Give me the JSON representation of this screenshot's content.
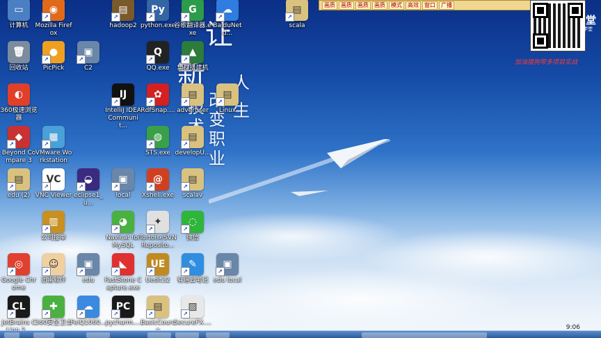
{
  "icons": [
    {
      "label": "计算机",
      "col": 0,
      "row": 0,
      "color": "#4a7fc4",
      "glyph": "▭",
      "sc": false
    },
    {
      "label": "Mozilla Firefox",
      "col": 1,
      "row": 0,
      "color": "#e06a1a",
      "glyph": "◉",
      "sc": true
    },
    {
      "label": "hadoop2",
      "col": 3,
      "row": 0,
      "color": "#7a5a2a",
      "glyph": "▤",
      "sc": true
    },
    {
      "label": "python.exe",
      "col": 4,
      "row": 0,
      "color": "#3465a4",
      "glyph": "Py",
      "sc": true
    },
    {
      "label": "谷歌翻译器.exe",
      "col": 5,
      "row": 0,
      "color": "#2c9c4a",
      "glyph": "G",
      "sc": true
    },
    {
      "label": "BaiduNetd...",
      "col": 6,
      "row": 0,
      "color": "#2f7de0",
      "glyph": "☁",
      "sc": true
    },
    {
      "label": "scala",
      "col": 8,
      "row": 0,
      "color": "#d9c280",
      "glyph": "▤",
      "sc": true
    },
    {
      "label": "回收站",
      "col": 0,
      "row": 1,
      "color": "#7d8c9c",
      "glyph": "🗑",
      "sc": false
    },
    {
      "label": "PicPick",
      "col": 1,
      "row": 1,
      "color": "#f0a020",
      "glyph": "●",
      "sc": true
    },
    {
      "label": "C2",
      "col": 2,
      "row": 1,
      "color": "#6a86a8",
      "glyph": "▣",
      "sc": true
    },
    {
      "label": "QQ.exe",
      "col": 4,
      "row": 1,
      "color": "#222222",
      "glyph": "Q",
      "sc": true
    },
    {
      "label": "集群搭建机",
      "col": 5,
      "row": 1,
      "color": "#2c7c3c",
      "glyph": "▲",
      "sc": true
    },
    {
      "label": "360极速浏览器",
      "col": 0,
      "row": 2,
      "color": "#e0402a",
      "glyph": "◐",
      "sc": false
    },
    {
      "label": "IntelliJ IDEA Communit...",
      "col": 3,
      "row": 2,
      "color": "#111111",
      "glyph": "IJ",
      "sc": true
    },
    {
      "label": "RdfSnap....",
      "col": 4,
      "row": 2,
      "color": "#d42020",
      "glyph": "✿",
      "sc": true
    },
    {
      "label": "advertiser",
      "col": 5,
      "row": 2,
      "color": "#d9c280",
      "glyph": "▤",
      "sc": true
    },
    {
      "label": "Linux",
      "col": 6,
      "row": 2,
      "color": "#d9c280",
      "glyph": "▤",
      "sc": true
    },
    {
      "label": "Beyond Compare 3",
      "col": 0,
      "row": 3,
      "color": "#c83232",
      "glyph": "◆",
      "sc": true
    },
    {
      "label": "VMware Workstation",
      "col": 1,
      "row": 3,
      "color": "#4aa0d8",
      "glyph": "▦",
      "sc": true
    },
    {
      "label": "STS.exe",
      "col": 4,
      "row": 3,
      "color": "#3aa048",
      "glyph": "◍",
      "sc": true
    },
    {
      "label": "developU...",
      "col": 5,
      "row": 3,
      "color": "#d9c280",
      "glyph": "▤",
      "sc": true
    },
    {
      "label": "edu (2)",
      "col": 0,
      "row": 4,
      "color": "#d9c280",
      "glyph": "▤",
      "sc": true
    },
    {
      "label": "VNC Viewer",
      "col": 1,
      "row": 4,
      "color": "#ffffff",
      "glyph": "VC",
      "sc": true
    },
    {
      "label": "eclipse1_u...",
      "col": 2,
      "row": 4,
      "color": "#3a2a80",
      "glyph": "◒",
      "sc": true
    },
    {
      "label": "local",
      "col": 3,
      "row": 4,
      "color": "#6a86a8",
      "glyph": "▣",
      "sc": true
    },
    {
      "label": "Xshell.exe",
      "col": 4,
      "row": 4,
      "color": "#d04020",
      "glyph": "@",
      "sc": true
    },
    {
      "label": "scalav",
      "col": 5,
      "row": 4,
      "color": "#d9c280",
      "glyph": "▤",
      "sc": true
    },
    {
      "label": "公司接单",
      "col": 1,
      "row": 5,
      "color": "#c89020",
      "glyph": "▥",
      "sc": true
    },
    {
      "label": "Navicat for MySQL",
      "col": 3,
      "row": 5,
      "color": "#4ab040",
      "glyph": "◕",
      "sc": true
    },
    {
      "label": "TortoiseSVN Reposito...",
      "col": 4,
      "row": 5,
      "color": "#e0e0e0",
      "glyph": "✦",
      "sc": true
    },
    {
      "label": "微信",
      "col": 5,
      "row": 5,
      "color": "#2fb53a",
      "glyph": "◌",
      "sc": true
    },
    {
      "label": "Google Chrome",
      "col": 0,
      "row": 6,
      "color": "#e04030",
      "glyph": "◎",
      "sc": true
    },
    {
      "label": "迅雷软件",
      "col": 1,
      "row": 6,
      "color": "#f0d0a0",
      "glyph": "☺",
      "sc": true
    },
    {
      "label": "edu",
      "col": 2,
      "row": 6,
      "color": "#6a86a8",
      "glyph": "▣",
      "sc": true
    },
    {
      "label": "FastStone Capture.exe",
      "col": 3,
      "row": 6,
      "color": "#e03030",
      "glyph": "◣",
      "sc": true
    },
    {
      "label": "Uedit32",
      "col": 4,
      "row": 6,
      "color": "#c08a20",
      "glyph": "UE",
      "sc": true
    },
    {
      "label": "有道云笔记",
      "col": 5,
      "row": 6,
      "color": "#2f8ee0",
      "glyph": "✎",
      "sc": true
    },
    {
      "label": "edu local",
      "col": 6,
      "row": 6,
      "color": "#6a86a8",
      "glyph": "▣",
      "sc": true
    },
    {
      "label": "JetBrains CLion 2...",
      "col": 0,
      "row": 7,
      "color": "#1a1a1a",
      "glyph": "CL",
      "sc": true
    },
    {
      "label": "360安全卫士",
      "col": 1,
      "row": 7,
      "color": "#4ab040",
      "glyph": "✚",
      "sc": true
    },
    {
      "label": "FeiQ1060...",
      "col": 2,
      "row": 7,
      "color": "#3a8ae0",
      "glyph": "☁",
      "sc": true
    },
    {
      "label": "pycharm....",
      "col": 3,
      "row": 7,
      "color": "#1a1a1a",
      "glyph": "PC",
      "sc": true
    },
    {
      "label": "BasicCource",
      "col": 4,
      "row": 7,
      "color": "#d9c280",
      "glyph": "▤",
      "sc": true
    },
    {
      "label": "SecureFX....",
      "col": 5,
      "row": 7,
      "color": "#e8e8e8",
      "glyph": "▨",
      "sc": true
    }
  ],
  "slogan": {
    "line1": "让",
    "line2": "新",
    "line3a": "人",
    "line3b": "生",
    "col2": "技术",
    "col3": "改变职业"
  },
  "toolbar": {
    "buttons": [
      "画质",
      "画质",
      "画质",
      "画质",
      "模式",
      "高效",
      "窗口",
      "广播"
    ]
  },
  "brand": {
    "text": "堂",
    "sub": "学堂"
  },
  "promo": "加油猎狗带多项目实战",
  "clock": "9:06"
}
